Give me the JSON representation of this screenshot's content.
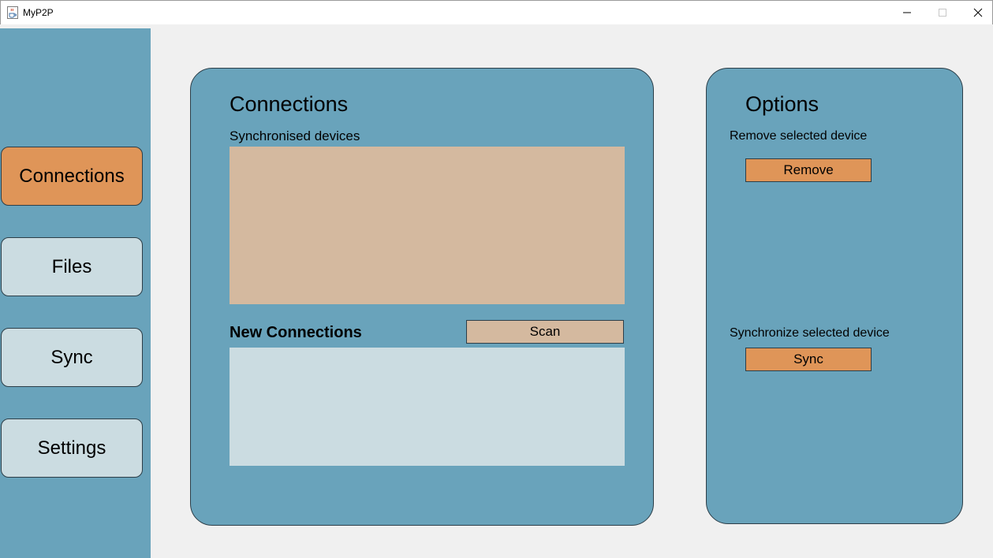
{
  "window": {
    "title": "MyP2P",
    "icon": "java-cup-icon",
    "controls": [
      "minimize-icon",
      "maximize-icon",
      "close-icon"
    ]
  },
  "sidebar": {
    "items": [
      {
        "label": "Connections",
        "active": true
      },
      {
        "label": "Files",
        "active": false
      },
      {
        "label": "Sync",
        "active": false
      },
      {
        "label": "Settings",
        "active": false
      }
    ]
  },
  "connections": {
    "title": "Connections",
    "synced_label": "Synchronised devices",
    "synced_devices": [],
    "new_label": "New Connections",
    "scan_label": "Scan",
    "new_devices": []
  },
  "options": {
    "title": "Options",
    "remove_label": "Remove selected device",
    "remove_button": "Remove",
    "sync_label": "Synchronize selected device",
    "sync_button": "Sync"
  },
  "colors": {
    "panel": "#69a3bb",
    "active": "#df9558",
    "inactive": "#cbdce1",
    "synced_list": "#d4b99f",
    "background": "#f0f0f0"
  }
}
